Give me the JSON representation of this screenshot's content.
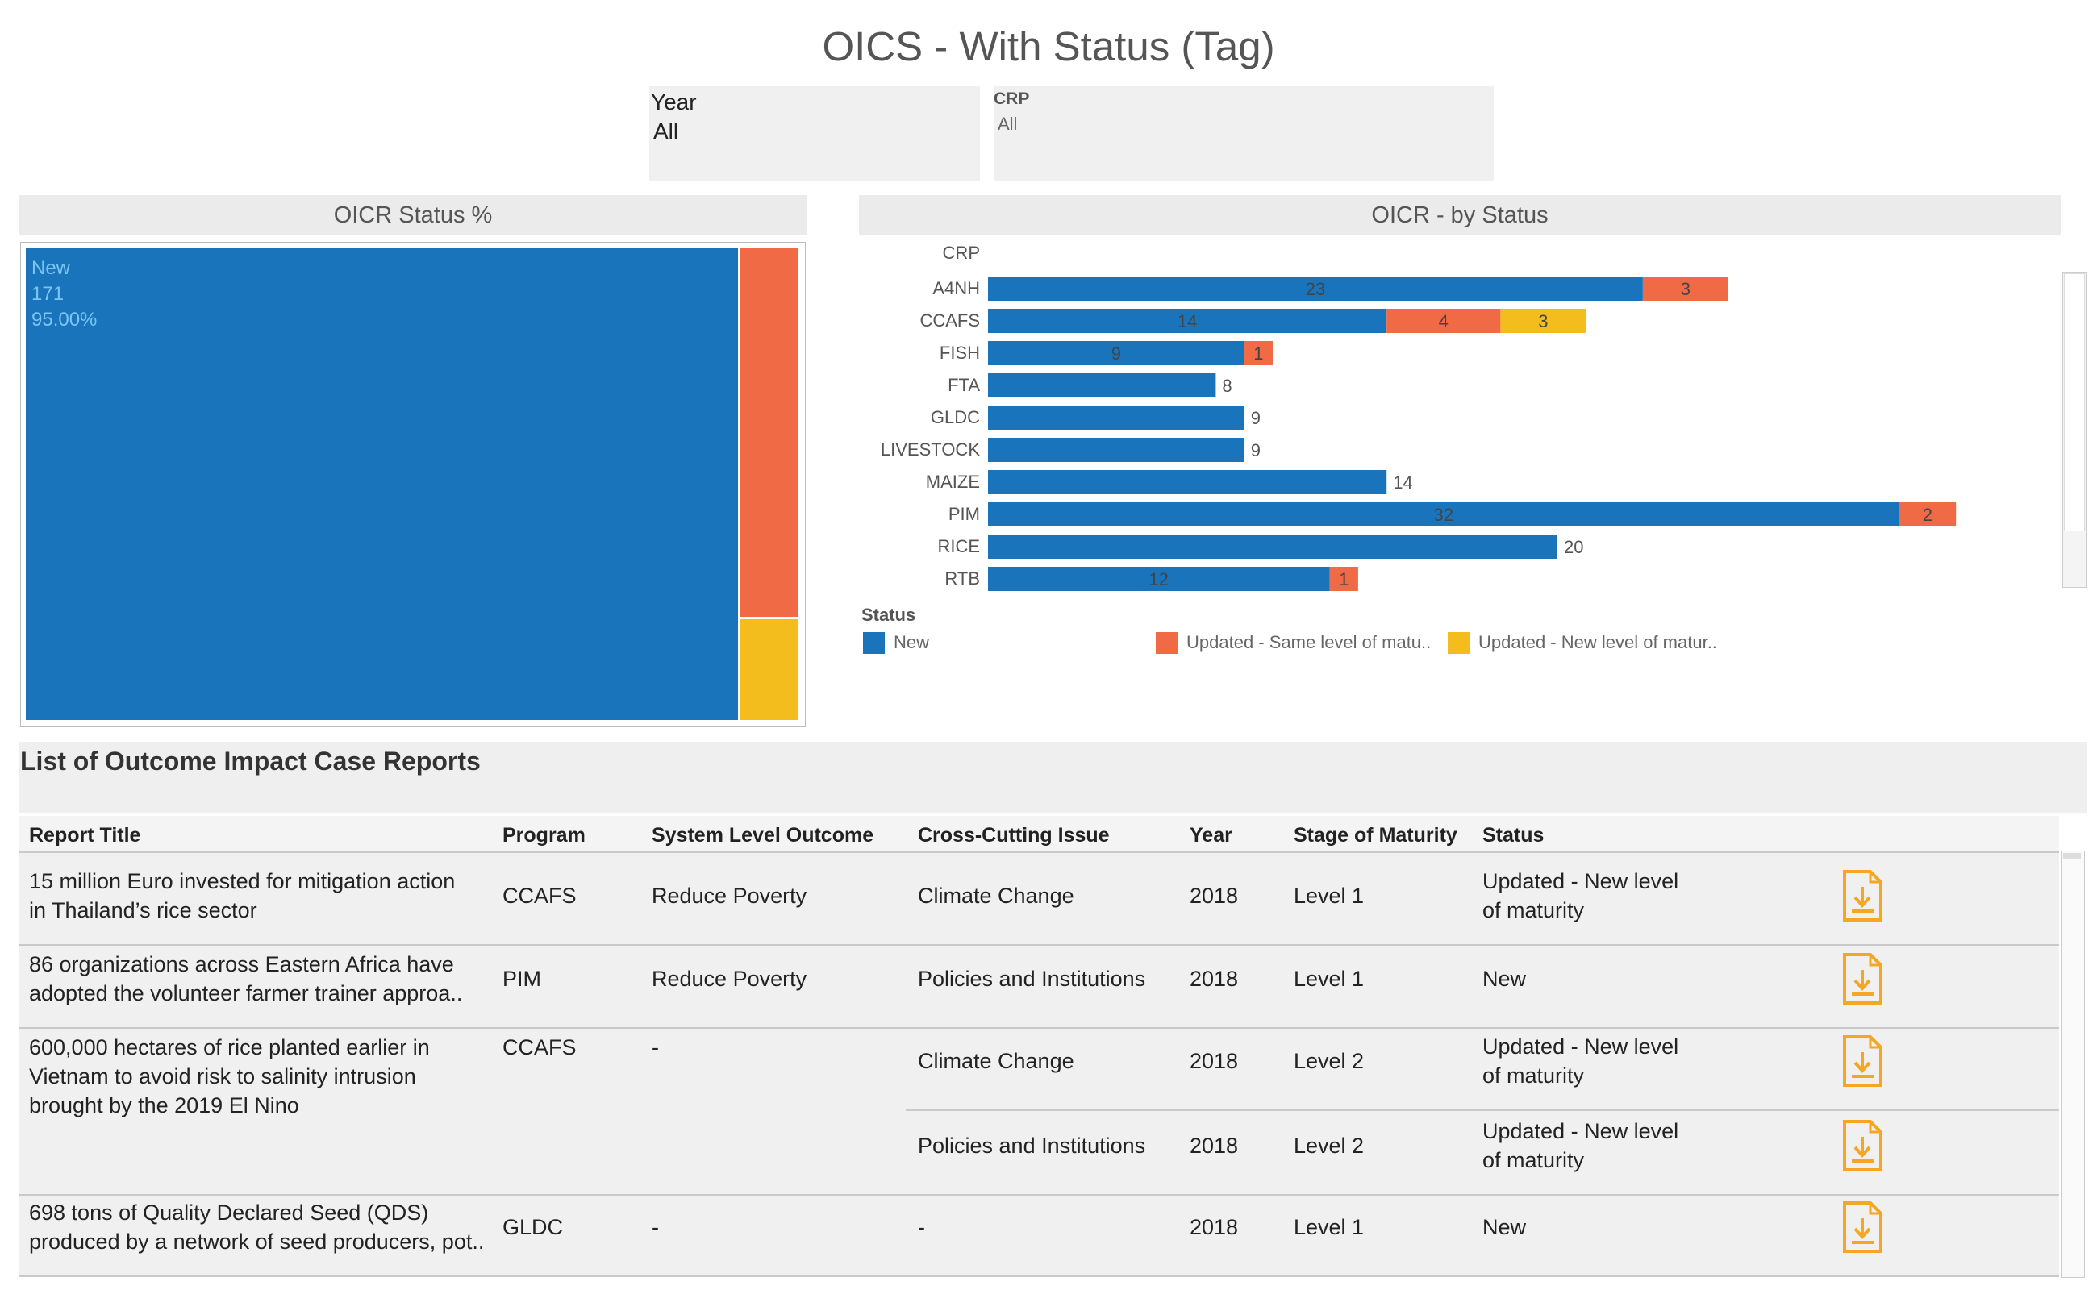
{
  "title": "OICS - With Status (Tag)",
  "filters": {
    "year": {
      "label": "Year",
      "value": "All"
    },
    "crp": {
      "label": "CRP",
      "value": "All"
    }
  },
  "status_pct": {
    "title": "OICR Status %",
    "new_label": "New",
    "new_count": "171",
    "new_pct": "95.00%"
  },
  "by_status": {
    "title": "OICR -  by Status"
  },
  "chart_data": {
    "type": "bar",
    "orientation": "horizontal",
    "stacked": true,
    "category_header": "CRP",
    "categories": [
      "A4NH",
      "CCAFS",
      "FISH",
      "FTA",
      "GLDC",
      "LIVESTOCK",
      "MAIZE",
      "PIM",
      "RICE",
      "RTB"
    ],
    "series": [
      {
        "name": "New",
        "color": "#1a74bb",
        "values": [
          23,
          14,
          9,
          8,
          9,
          9,
          14,
          32,
          20,
          12
        ]
      },
      {
        "name": "Updated - Same level of matu..",
        "color": "#ef6a45",
        "values": [
          3,
          4,
          1,
          0,
          0,
          0,
          0,
          2,
          0,
          1
        ]
      },
      {
        "name": "Updated - New level of matur..",
        "color": "#f3bd1e",
        "values": [
          0,
          3,
          0,
          0,
          0,
          0,
          0,
          0,
          0,
          0
        ]
      }
    ],
    "legend_title": "Status",
    "legend_position": "bottom"
  },
  "list": {
    "title": "List of Outcome Impact Case Reports",
    "columns": [
      "Report Title",
      "Program",
      "System Level Outcome",
      "Cross-Cutting Issue",
      "Year",
      "Stage of Maturity",
      "Status"
    ],
    "rows": [
      {
        "title": [
          "15 million Euro invested for mitigation action",
          "in Thailand’s rice sector"
        ],
        "program": "CCAFS",
        "slo": "Reduce Poverty",
        "issue": "Climate Change",
        "year": "2018",
        "stage": "Level 1",
        "status": [
          "Updated - New level",
          "of maturity"
        ]
      },
      {
        "title": [
          "86 organizations across Eastern Africa have",
          "adopted the volunteer farmer trainer approa.."
        ],
        "program": "PIM",
        "slo": "Reduce Poverty",
        "issue": "Policies and Institutions",
        "year": "2018",
        "stage": "Level 1",
        "status": [
          "New"
        ]
      },
      {
        "title": [
          "600,000 hectares of rice planted earlier in",
          "Vietnam to avoid risk to salinity intrusion",
          "brought by the 2019 El Nino"
        ],
        "program": "CCAFS",
        "slo": "-",
        "issue": "Climate Change",
        "year": "2018",
        "stage": "Level 2",
        "status": [
          "Updated - New level",
          "of maturity"
        ]
      },
      {
        "title": [],
        "program": "",
        "slo": "",
        "issue": "Policies and Institutions",
        "year": "2018",
        "stage": "Level 2",
        "status": [
          "Updated - New level",
          "of maturity"
        ]
      },
      {
        "title": [
          "698 tons of Quality Declared Seed (QDS)",
          "produced by a network of seed producers, pot.."
        ],
        "program": "GLDC",
        "slo": "-",
        "issue": "-",
        "year": "2018",
        "stage": "Level 1",
        "status": [
          "New"
        ]
      }
    ]
  }
}
